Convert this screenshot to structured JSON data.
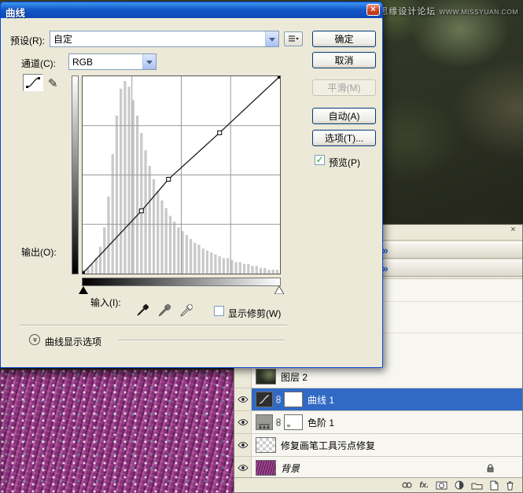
{
  "window": {
    "title": "曲线",
    "close_glyph": "×"
  },
  "watermark": {
    "site_name": "思缘设计论坛",
    "site_url": "WWW.MISSYUAN.COM"
  },
  "curves_dialog": {
    "preset_label": "预设(R):",
    "preset_value": "自定",
    "channel_label": "通道(C):",
    "channel_value": "RGB",
    "ok_label": "确定",
    "cancel_label": "取消",
    "smooth_label": "平滑(M)",
    "auto_label": "自动(A)",
    "options_label": "选项(T)...",
    "preview_label": "预览(P)",
    "preview_checked_glyph": "✓",
    "output_label": "输出(O):",
    "input_label": "输入(I):",
    "show_clipping_label": "显示修剪(W)",
    "display_options_label": "曲线显示选项",
    "curve_graph": {
      "points": [
        [
          0,
          0
        ],
        [
          76,
          81
        ],
        [
          111,
          122
        ],
        [
          177,
          182
        ],
        [
          255,
          255
        ]
      ],
      "histogram": [
        2,
        3,
        5,
        8,
        14,
        24,
        40,
        62,
        82,
        96,
        100,
        97,
        90,
        82,
        73,
        64,
        56,
        49,
        43,
        38,
        34,
        30,
        27,
        24,
        22,
        20,
        18,
        16,
        15,
        13,
        12,
        11,
        10,
        9,
        8,
        8,
        7,
        6,
        6,
        5,
        5,
        4,
        4,
        3,
        3,
        2,
        2,
        2
      ]
    }
  },
  "layers_panel": {
    "close_glyph": "×",
    "expand_glyph": "»",
    "fx_label": "fx.",
    "layers": [
      {
        "name": "图层 2",
        "visible": false,
        "selected": false,
        "kind": "image"
      },
      {
        "name": "曲线 1",
        "visible": true,
        "selected": true,
        "kind": "curves-adjustment"
      },
      {
        "name": "色阶 1",
        "visible": true,
        "selected": false,
        "kind": "levels-adjustment"
      },
      {
        "name": "修复画笔工具污点修复",
        "visible": true,
        "selected": false,
        "kind": "pixels"
      },
      {
        "name": "背景",
        "visible": true,
        "selected": false,
        "kind": "background",
        "locked": true
      }
    ]
  }
}
